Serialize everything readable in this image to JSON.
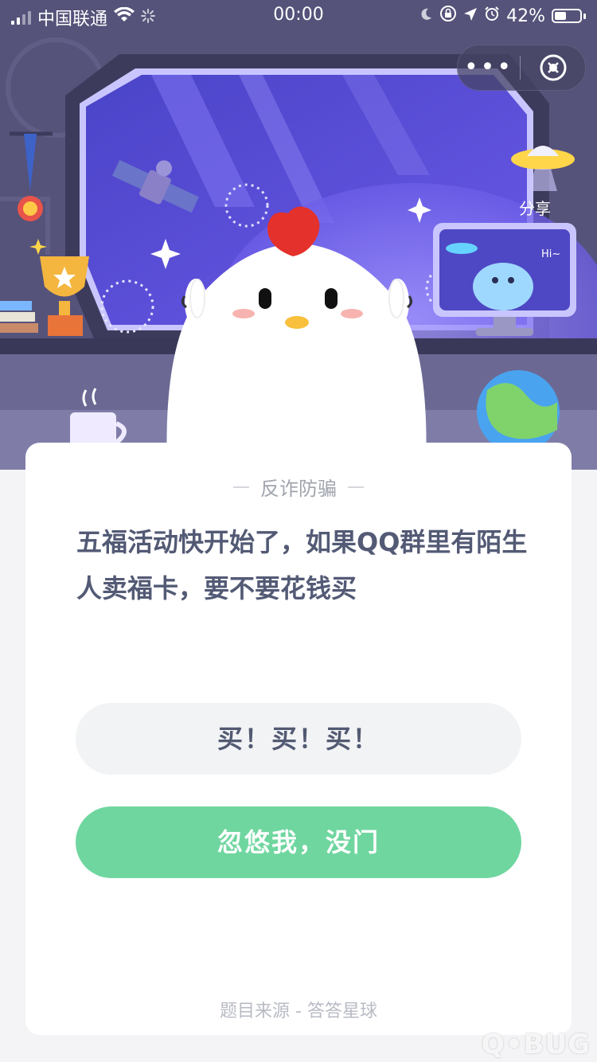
{
  "status_bar": {
    "carrier": "中国联通",
    "time": "00:00",
    "battery": "42%",
    "battery_level": 0.42
  },
  "header": {
    "more_label": "•••",
    "share_label": "分享"
  },
  "scene": {
    "speech_text": "Hi~"
  },
  "quiz": {
    "category": "反诈防骗",
    "question": "五福活动快开始了，如果QQ群里有陌生人卖福卡，要不要花钱买",
    "options": [
      "买！买！买！",
      "忽悠我，没门"
    ],
    "source": "题目来源 - 答答星球"
  },
  "watermark": "Q•BUG",
  "colors": {
    "scene_bg": "#54527a",
    "window_glass": "#5a4fd8",
    "accent_green": "#6fd69f",
    "option_gray": "#f2f3f5",
    "question_text": "#535a75"
  },
  "icons": [
    "signal-icon",
    "wifi-icon",
    "loading-icon",
    "moon-icon",
    "orientation-lock-icon",
    "location-icon",
    "alarm-icon",
    "battery-icon",
    "close-icon"
  ]
}
